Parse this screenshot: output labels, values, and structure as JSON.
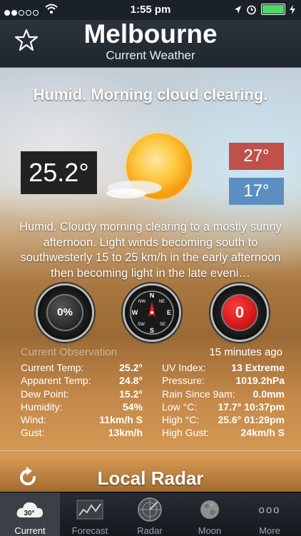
{
  "status": {
    "time": "1:55 pm"
  },
  "header": {
    "city": "Melbourne",
    "subtitle": "Current Weather"
  },
  "forecast": {
    "headline": "Humid. Morning cloud clearing.",
    "current_temp": "25.2°",
    "high": "27°",
    "low": "17°",
    "description": "Humid. Cloudy morning clearing to a mostly sunny afternoon. Light winds becoming south to southwesterly 15 to 25 km/h in the early afternoon then becoming light in the late eveni…"
  },
  "gauges": {
    "humidity_left": "0%",
    "compass_letters": [
      "N",
      "NE",
      "E",
      "SE",
      "S",
      "SW",
      "W",
      "NW"
    ],
    "uv_right": "0"
  },
  "observation": {
    "title": "Current Observation",
    "ago": "15 minutes ago",
    "left": [
      {
        "label": "Current Temp:",
        "value": "25.2°"
      },
      {
        "label": "Apparent Temp:",
        "value": "24.8°"
      },
      {
        "label": "Dew Point:",
        "value": "15.2°"
      },
      {
        "label": "Humidity:",
        "value": "54%"
      },
      {
        "label": "Wind:",
        "value": "11km/h S"
      },
      {
        "label": "Gust:",
        "value": "13km/h"
      }
    ],
    "right": [
      {
        "label": "UV Index:",
        "value": "13 Extreme"
      },
      {
        "label": "Pressure:",
        "value": "1019.2hPa"
      },
      {
        "label": "Rain Since 9am:",
        "value": "0.0mm"
      },
      {
        "label": "Low °C:",
        "value": "17.7° 10:37pm"
      },
      {
        "label": "High °C:",
        "value": "25.6° 01:29pm"
      },
      {
        "label": "High Gust:",
        "value": "24km/h S"
      }
    ]
  },
  "radar": {
    "title": "Local Radar"
  },
  "tabs": [
    {
      "label": "Current",
      "badge": "30°",
      "icon": "cloud-icon"
    },
    {
      "label": "Forecast",
      "icon": "chart-icon"
    },
    {
      "label": "Radar",
      "icon": "radar-icon"
    },
    {
      "label": "Moon",
      "icon": "moon-icon"
    },
    {
      "label": "More",
      "badge": "ooo",
      "icon": "more-icon"
    }
  ],
  "colors": {
    "high": "#c0504a",
    "low": "#5b8fc0",
    "battery": "#4cd964",
    "uv_gauge": "#d00000"
  }
}
